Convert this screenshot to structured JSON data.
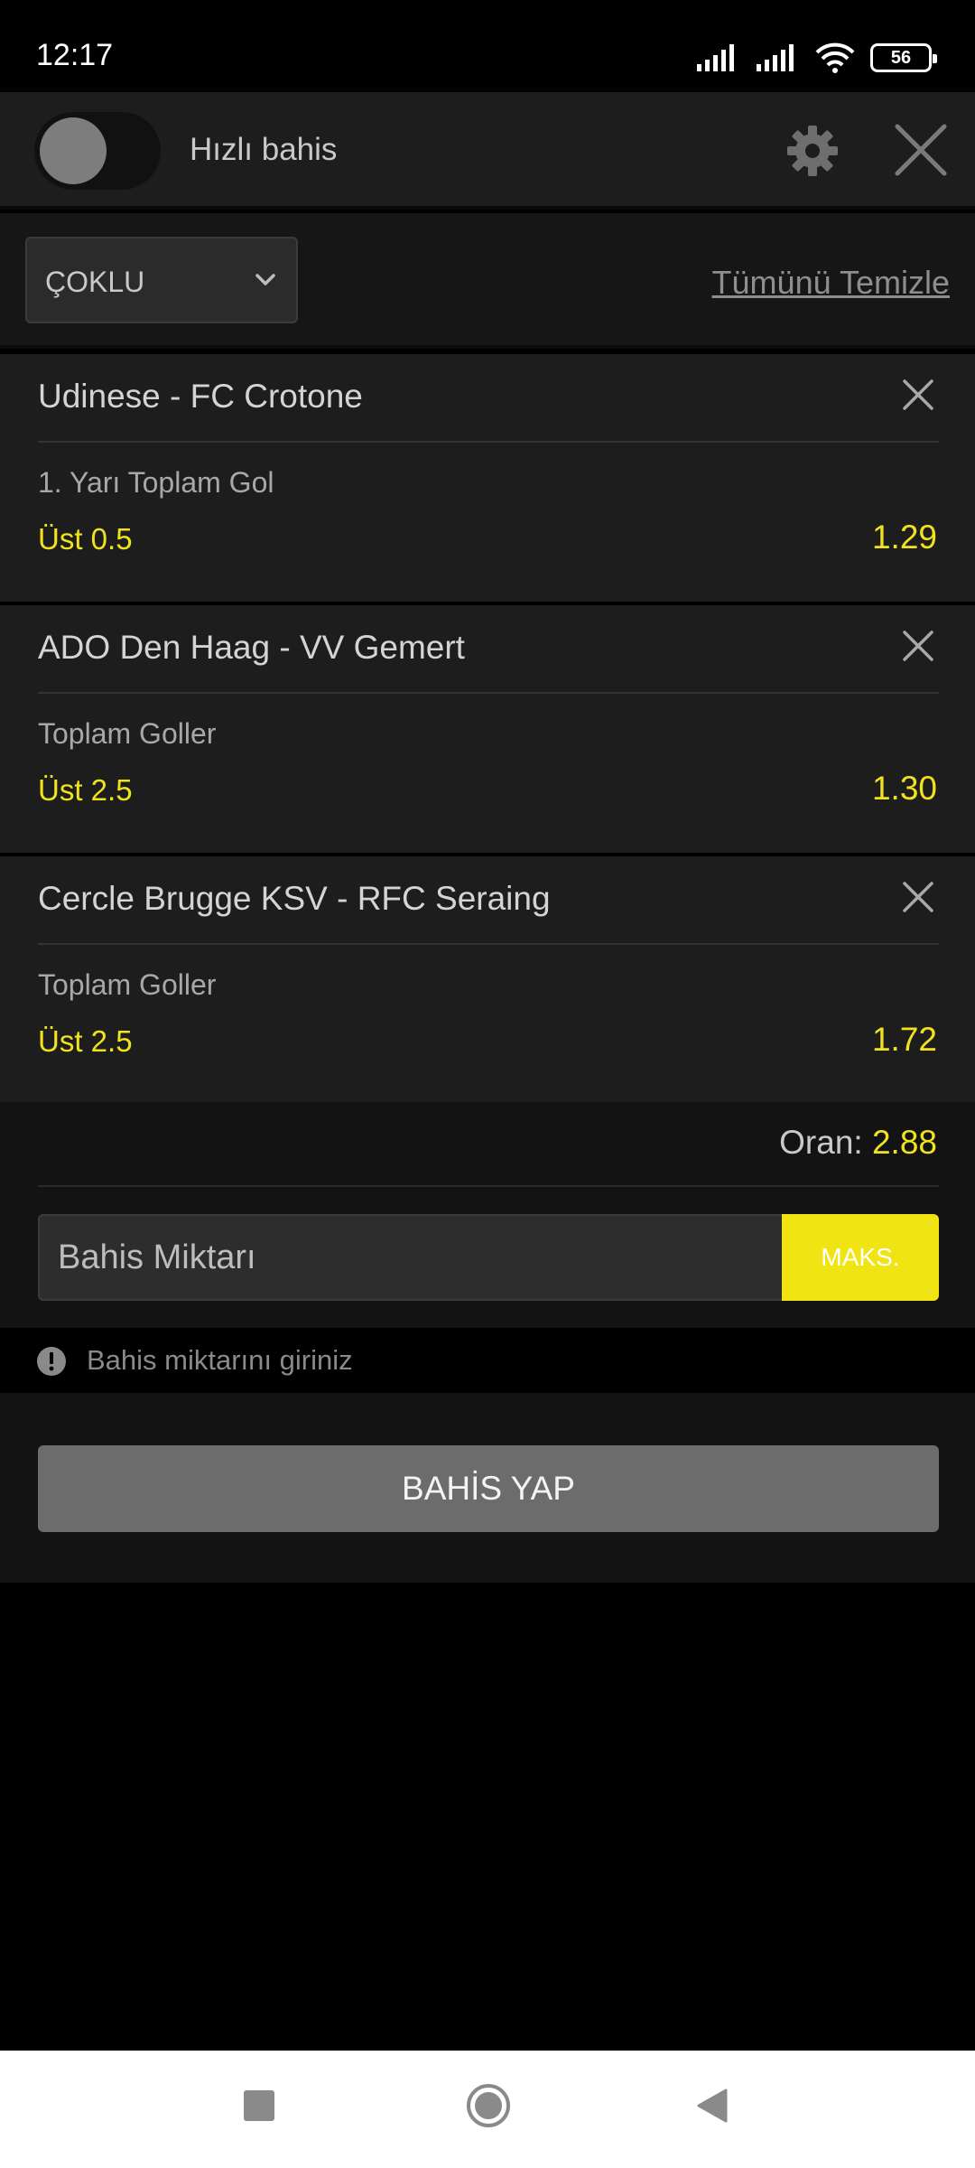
{
  "status_bar": {
    "time": "12:17",
    "battery": "56",
    "icons": [
      "signal-icon",
      "signal-icon",
      "wifi-icon",
      "battery-icon"
    ]
  },
  "header": {
    "quick_bet_label": "Hızlı bahis",
    "quick_bet_enabled": false,
    "settings_icon": "gear-icon",
    "close_icon": "close-icon"
  },
  "toolbar": {
    "bet_type": "ÇOKLU",
    "clear_all_label": "Tümünü Temizle"
  },
  "bets": [
    {
      "match": "Udinese - FC Crotone",
      "market": "1. Yarı Toplam Gol",
      "selection": "Üst 0.5",
      "odds": "1.29"
    },
    {
      "match": "ADO Den Haag - VV Gemert",
      "market": "Toplam Goller",
      "selection": "Üst 2.5",
      "odds": "1.30"
    },
    {
      "match": "Cercle Brugge KSV - RFC Seraing",
      "market": "Toplam Goller",
      "selection": "Üst 2.5",
      "odds": "1.72"
    }
  ],
  "summary": {
    "odds_label": "Oran:",
    "total_odds": "2.88",
    "stake_placeholder": "Bahis Miktarı",
    "max_label": "MAKS."
  },
  "warning": {
    "text": "Bahis miktarını giriniz"
  },
  "place_bet_label": "BAHİS YAP",
  "colors": {
    "accent": "#f0e413",
    "background": "#000000",
    "card": "#1d1d1d",
    "button_disabled": "#6c6c6c"
  }
}
